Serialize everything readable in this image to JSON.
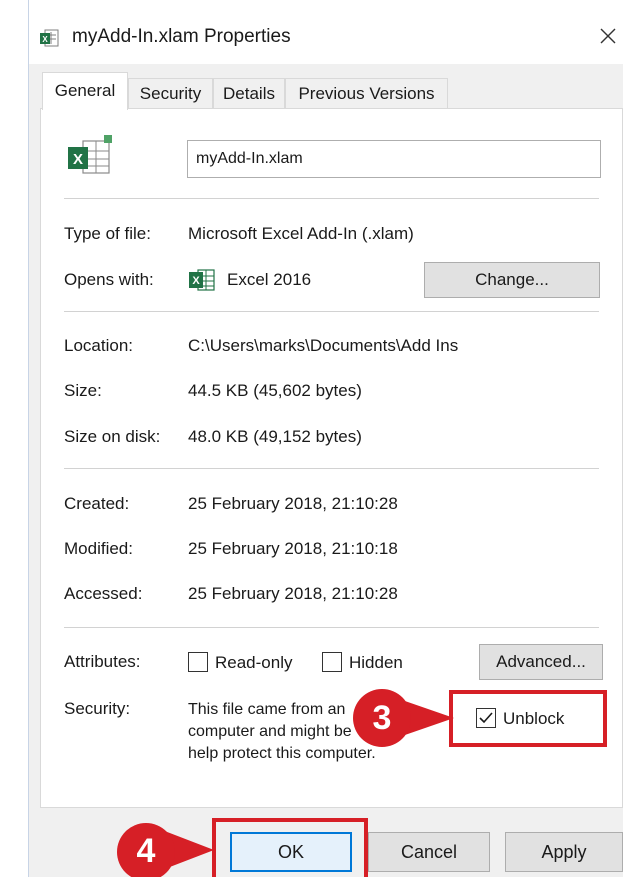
{
  "window": {
    "title": "myAdd-In.xlam Properties",
    "close_symbol": "✕"
  },
  "tabs": [
    {
      "label": "General",
      "active": true
    },
    {
      "label": "Security",
      "active": false
    },
    {
      "label": "Details",
      "active": false
    },
    {
      "label": "Previous Versions",
      "active": false
    }
  ],
  "general": {
    "filename": "myAdd-In.xlam",
    "type_label": "Type of file:",
    "type_value": "Microsoft Excel Add-In (.xlam)",
    "opens_label": "Opens with:",
    "opens_value": "Excel 2016",
    "change_button": "Change...",
    "location_label": "Location:",
    "location_value": "C:\\Users\\marks\\Documents\\Add Ins",
    "size_label": "Size:",
    "size_value": "44.5 KB (45,602 bytes)",
    "size_disk_label": "Size on disk:",
    "size_disk_value": "48.0 KB (49,152 bytes)",
    "created_label": "Created:",
    "created_value": "25 February 2018, 21:10:28",
    "modified_label": "Modified:",
    "modified_value": "25 February 2018, 21:10:18",
    "accessed_label": "Accessed:",
    "accessed_value": "25 February 2018, 21:10:28",
    "attributes_label": "Attributes:",
    "readonly_label": "Read-only",
    "readonly_checked": false,
    "hidden_label": "Hidden",
    "hidden_checked": false,
    "advanced_button": "Advanced...",
    "security_label": "Security:",
    "security_lines": [
      "This file came from an",
      "computer and might be",
      "help protect this computer."
    ],
    "unblock_label": "Unblock",
    "unblock_checked": true
  },
  "callouts": [
    {
      "number": "3",
      "color": "#d61f26"
    },
    {
      "number": "4",
      "color": "#d61f26"
    }
  ],
  "buttons": {
    "ok": "OK",
    "cancel": "Cancel",
    "apply": "Apply"
  },
  "colors": {
    "excel_green": "#217346",
    "highlight_red": "#d61f26",
    "focus_blue": "#0078d7"
  },
  "icons": {
    "title": "excel-file-icon",
    "file": "excel-file-icon",
    "opens_with": "excel-app-icon",
    "close": "close-icon",
    "check": "checkmark-icon"
  }
}
